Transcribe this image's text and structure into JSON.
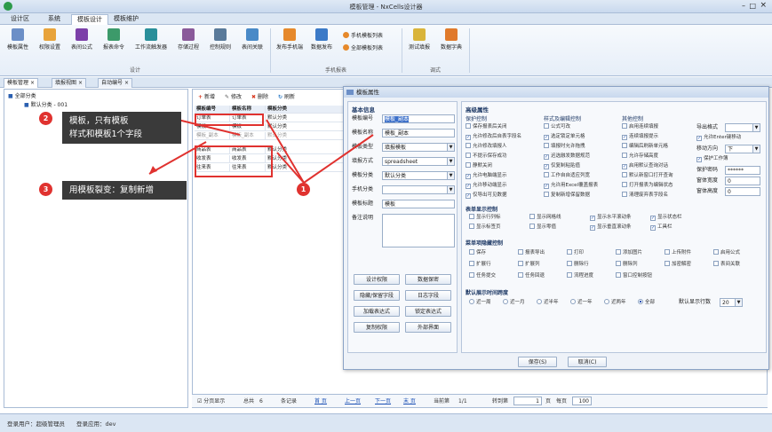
{
  "window": {
    "title": "模板管理 - NxCells设计器",
    "icon": "app-logo-icon"
  },
  "menu": [
    "设计区",
    "系统",
    "模板设计",
    "模板维护"
  ],
  "ribbon": {
    "group1": {
      "label": "设计",
      "buttons": [
        "模板属性",
        "权限设置",
        "表间公式",
        "报表命令",
        "工作流触发器",
        "存储过程",
        "控制规则",
        "表间关联"
      ]
    },
    "group2": {
      "label": "手机报表",
      "buttons": [
        "发布手机端",
        "数据发布"
      ],
      "small": [
        "手机模板列表",
        "全部模板列表"
      ]
    },
    "group3": {
      "label": "调式",
      "buttons": [
        "测试填报",
        "数据字典"
      ]
    }
  },
  "doctabs": [
    "模板管理",
    "填报视图",
    "自动编号"
  ],
  "tree": {
    "root": "全部分类",
    "child": "默认分类 - 001"
  },
  "grid": {
    "toolbar": [
      "新增",
      "修改",
      "删除",
      "刷新"
    ],
    "headers": [
      "模板编号",
      "模板名称",
      "模板分类"
    ],
    "rows": [
      [
        "订单表",
        "订单表",
        "默认分类"
      ],
      [
        "模板",
        "模板",
        "默认分类"
      ],
      [
        "模板_副本",
        "模板_副本",
        "默认分类"
      ],
      [
        "商品表",
        "商品表",
        "默认分类"
      ],
      [
        "收发表",
        "收发表",
        "默认分类"
      ],
      [
        "往来表",
        "往来表",
        "默认分类"
      ]
    ]
  },
  "pager": {
    "show_page": "分页显示",
    "total": "总共",
    "total_num": "6",
    "records": "条记录",
    "first": "首 页",
    "prev": "上一页",
    "next": "下一页",
    "last": "末 页",
    "current": "当前第",
    "current_val": "1/1",
    "goto": "转到第",
    "goto_val": "1",
    "page_unit": "页",
    "per_page": "每页",
    "per_page_val": "100"
  },
  "status": {
    "user": "登录用户：超级管理员",
    "app": "登录应用：dev"
  },
  "dialog": {
    "title": "模板属性",
    "basic": {
      "header": "基本信息",
      "fields": [
        {
          "label": "模板编号",
          "value": "模板_副本"
        },
        {
          "label": "模板名称",
          "value": "模板_副本"
        },
        {
          "label": "模板类型",
          "value": "填报模板"
        },
        {
          "label": "填报方式",
          "value": "spreadsheet"
        },
        {
          "label": "模板分类",
          "value": "默认分类"
        },
        {
          "label": "手机分类",
          "value": ""
        },
        {
          "label": "模板标题",
          "value": "模板"
        },
        {
          "label": "备注说明",
          "value": ""
        }
      ],
      "buttons": [
        "设计权限",
        "数据保密",
        "隐藏/保留字段",
        "日志字段",
        "加载表达式",
        "锁定表达式",
        "复制权限",
        "外部界面"
      ]
    },
    "advanced": {
      "header": "高级属性",
      "col1": {
        "header": "保护控制",
        "items": [
          "保存报表后关闭",
          "允许修改后自表字段名",
          "允许修改填报人",
          "不提示保存成功",
          "静默关闭",
          "允许电脑端显示",
          "允许移动端显示",
          "仅导出可见数据"
        ],
        "checked": [
          false,
          true,
          false,
          false,
          false,
          true,
          true,
          true
        ]
      },
      "col2": {
        "header": "样式及编辑控制",
        "items": [
          "公式可改",
          "选定锁定单元格",
          "填报时允许拖拽",
          "迟选融发数据规范",
          "仅复制粘贴值",
          "工作自自适应列宽",
          "允许用Excel覆盖报表",
          "复制新增保留数据"
        ],
        "checked": [
          false,
          true,
          false,
          true,
          true,
          false,
          true,
          false
        ]
      },
      "col3": {
        "header": "其他控制",
        "items": [
          "启用连续填报",
          "连续填报提示",
          "编辑后刷新单元格",
          "允许存储高度",
          "启用默认查询对话",
          "默认新窗口打开查询",
          "打开报表为编辑状态",
          "清理废弃表字段名"
        ],
        "checked": [
          false,
          true,
          false,
          false,
          true,
          false,
          false,
          false
        ]
      },
      "col4": {
        "items": [
          {
            "label": "导出格式",
            "value": ""
          },
          {
            "label": "允许Enter键移动",
            "value": ""
          },
          {
            "label": "移动方向",
            "value": "下"
          },
          {
            "label": "保护工作簿",
            "value": ""
          },
          {
            "label": "保护密码",
            "value": "******"
          },
          {
            "label": "窗体宽度",
            "value": "0"
          },
          {
            "label": "窗体高度",
            "value": "0"
          }
        ]
      },
      "display": {
        "header": "表单显示控制",
        "items": [
          "显示行列标",
          "显示网格线",
          "显示水平滚动条",
          "显示状态栏",
          "显示标签页",
          "显示零值",
          "显示垂直滚动条",
          "工具栏"
        ],
        "checked": [
          false,
          false,
          true,
          true,
          false,
          false,
          true,
          true
        ]
      },
      "menu": {
        "header": "菜单项隐藏控制",
        "items": [
          "保存",
          "报表导出",
          "打印",
          "添加图片",
          "上传附件",
          "启用公式",
          "扩展行",
          "扩展列",
          "删除行",
          "删除列",
          "加密解密",
          "表间关联",
          "任务提交",
          "任务回退",
          "流程进度",
          "窗口控制按钮"
        ]
      },
      "period": {
        "header": "默认展示时间跨度",
        "items": [
          "近一周",
          "近一月",
          "近半年",
          "近一年",
          "近两年",
          "全部"
        ],
        "selected": 5,
        "rows_label": "默认显示行数",
        "rows_value": "20"
      }
    },
    "save": "保存(S)",
    "cancel": "取消(C)"
  },
  "annotations": {
    "callout2": [
      "模板，只有模板",
      "样式和模板1个字段"
    ],
    "callout3": "用模板裂变：复制新增",
    "badges": [
      "1",
      "2",
      "3"
    ]
  }
}
